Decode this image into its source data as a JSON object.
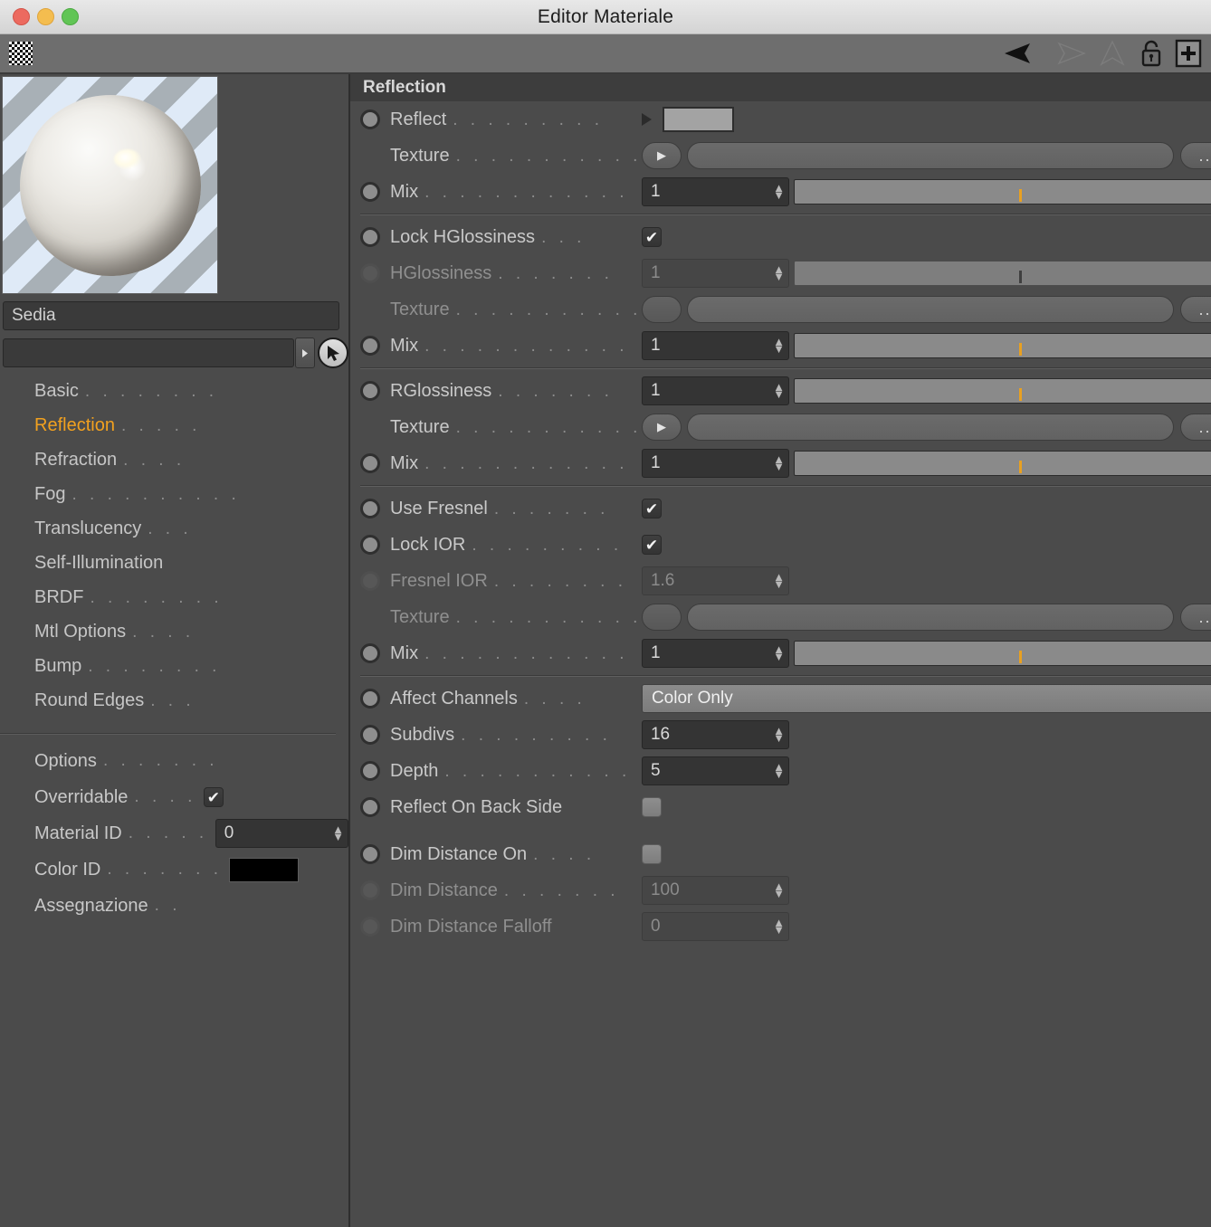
{
  "window": {
    "title": "Editor Materiale",
    "traffic_lights": [
      "close",
      "minimize",
      "zoom"
    ]
  },
  "toolbar": {
    "checker_icon": "checker-pattern-icon",
    "back_arrow": "back-arrow-icon",
    "forward_arrow": "forward-arrow-icon",
    "up_arrow": "up-arrow-icon",
    "lock": "lock-icon",
    "add": "plus-icon"
  },
  "left_panel": {
    "preview_label": "material-preview-sphere",
    "material_name": "Sedia",
    "shader_field_value": "",
    "shader_arrow": "play-arrow-icon",
    "picker_icon": "cursor-pick-icon",
    "nav_items": [
      {
        "label": "Basic",
        "dots": ". . . . . . . .",
        "active": false
      },
      {
        "label": "Reflection",
        "dots": ". . . . .",
        "active": true
      },
      {
        "label": "Refraction",
        "dots": ". . . .",
        "active": false
      },
      {
        "label": "Fog",
        "dots": ". . . . . . . . . .",
        "active": false
      },
      {
        "label": "Translucency",
        "dots": ". . .",
        "active": false
      },
      {
        "label": "Self-Illumination",
        "dots": "",
        "active": false
      },
      {
        "label": "BRDF",
        "dots": ". . . . . . . .",
        "active": false
      },
      {
        "label": "Mtl Options",
        "dots": ". . . .",
        "active": false
      },
      {
        "label": "Bump",
        "dots": ". . . . . . . .",
        "active": false
      },
      {
        "label": "Round Edges",
        "dots": ". . .",
        "active": false
      }
    ],
    "options": {
      "options_label": "Options",
      "options_dots": ". . . . . . .",
      "overridable_label": "Overridable",
      "overridable_dots": ". . . .",
      "overridable_checked": true,
      "material_id_label": "Material ID",
      "material_id_dots": ". . . . .",
      "material_id_value": "0",
      "color_id_label": "Color ID",
      "color_id_dots": ". . . . . . .",
      "color_id_value": "#000000",
      "assegnazione_label": "Assegnazione",
      "assegnazione_dots": ". ."
    }
  },
  "reflection": {
    "header": "Reflection",
    "rows": {
      "reflect": {
        "label": "Reflect",
        "dots": ". . . . . . . . .",
        "swatch_color": "#a3a3a3"
      },
      "reflect_texture": {
        "label": "Texture",
        "dots": ". . . . . . . . . . .",
        "value": "",
        "browse": "..."
      },
      "reflect_mix": {
        "label": "Mix",
        "dots": ". . . . . . . . . . . .",
        "value": "1",
        "slider_pct": 100
      },
      "lock_hglossiness": {
        "label": "Lock HGlossiness",
        "dots": ". . .",
        "checked": true
      },
      "hglossiness": {
        "label": "HGlossiness",
        "dots": ". . . . . . .",
        "value": "1",
        "disabled": true,
        "slider_pct": 100
      },
      "hglossiness_texture": {
        "label": "Texture",
        "dots": ". . . . . . . . . . .",
        "value": "",
        "browse": "...",
        "disabled": true
      },
      "hglossiness_mix": {
        "label": "Mix",
        "dots": ". . . . . . . . . . . .",
        "value": "1",
        "slider_pct": 100
      },
      "rglossiness": {
        "label": "RGlossiness",
        "dots": ". . . . . . .",
        "value": "1",
        "slider_pct": 100
      },
      "rglossiness_texture": {
        "label": "Texture",
        "dots": ". . . . . . . . . . .",
        "value": "",
        "browse": "..."
      },
      "rglossiness_mix": {
        "label": "Mix",
        "dots": ". . . . . . . . . . . .",
        "value": "1",
        "slider_pct": 100
      },
      "use_fresnel": {
        "label": "Use Fresnel",
        "dots": ". . . . . . .",
        "checked": true
      },
      "lock_ior": {
        "label": "Lock IOR",
        "dots": ". . . . . . . . .",
        "checked": true
      },
      "fresnel_ior": {
        "label": "Fresnel IOR",
        "dots": ". . . . . . . .",
        "value": "1.6",
        "disabled": true
      },
      "fresnel_texture": {
        "label": "Texture",
        "dots": ". . . . . . . . . . .",
        "value": "",
        "browse": "...",
        "disabled": true
      },
      "fresnel_mix": {
        "label": "Mix",
        "dots": ". . . . . . . . . . . .",
        "value": "1",
        "slider_pct": 100
      },
      "affect_channels": {
        "label": "Affect Channels",
        "dots": ". . . .",
        "value": "Color Only"
      },
      "subdivs": {
        "label": "Subdivs",
        "dots": ". . . . . . . . .",
        "value": "16"
      },
      "depth": {
        "label": "Depth",
        "dots": ". . . . . . . . . . .",
        "value": "5"
      },
      "reflect_on_back_side": {
        "label": "Reflect On Back Side",
        "dots": "",
        "checked": false
      },
      "dim_distance_on": {
        "label": "Dim Distance On",
        "dots": ". . . .",
        "checked": false
      },
      "dim_distance": {
        "label": "Dim Distance",
        "dots": ". . . . . . .",
        "value": "100",
        "disabled": true
      },
      "dim_distance_falloff": {
        "label": "Dim Distance Falloff",
        "dots": "",
        "value": "0",
        "disabled": true
      }
    }
  },
  "colors": {
    "accent": "#f2a11f",
    "panel_bg": "#4b4b4b",
    "header_bg": "#3d3d3d",
    "field_bg": "#343434"
  }
}
